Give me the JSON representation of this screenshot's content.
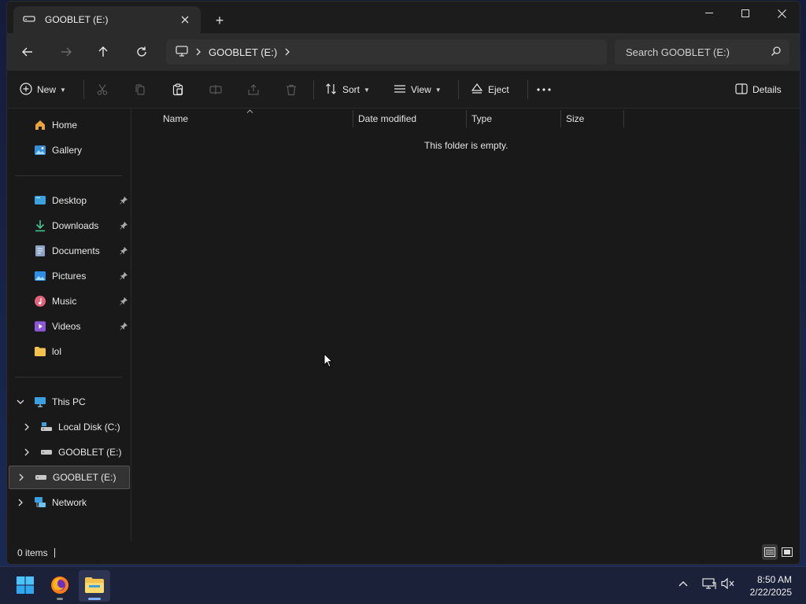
{
  "window": {
    "tab_title": "GOOBLET (E:)",
    "new_tab": "+"
  },
  "address": {
    "crumb": "GOOBLET (E:)",
    "search_placeholder": "Search GOOBLET (E:)"
  },
  "toolbar": {
    "new_label": "New",
    "sort_label": "Sort",
    "view_label": "View",
    "eject_label": "Eject",
    "details_label": "Details"
  },
  "sidebar": {
    "home": "Home",
    "gallery": "Gallery",
    "quick": [
      {
        "label": "Desktop"
      },
      {
        "label": "Downloads"
      },
      {
        "label": "Documents"
      },
      {
        "label": "Pictures"
      },
      {
        "label": "Music"
      },
      {
        "label": "Videos"
      },
      {
        "label": "lol"
      }
    ],
    "this_pc": "This PC",
    "local_disk": "Local Disk (C:)",
    "gooblet_child": "GOOBLET (E:)",
    "gooblet_root": "GOOBLET (E:)",
    "network": "Network"
  },
  "columns": {
    "name": "Name",
    "date_modified": "Date modified",
    "type": "Type",
    "size": "Size"
  },
  "content": {
    "empty_message": "This folder is empty."
  },
  "status": {
    "item_count": "0 items"
  },
  "taskbar": {
    "time": "8:50 AM",
    "date": "2/22/2025"
  },
  "colors": {
    "accent": "#7fb0ff",
    "folder": "#f2c14e",
    "window_bg": "#191919"
  }
}
